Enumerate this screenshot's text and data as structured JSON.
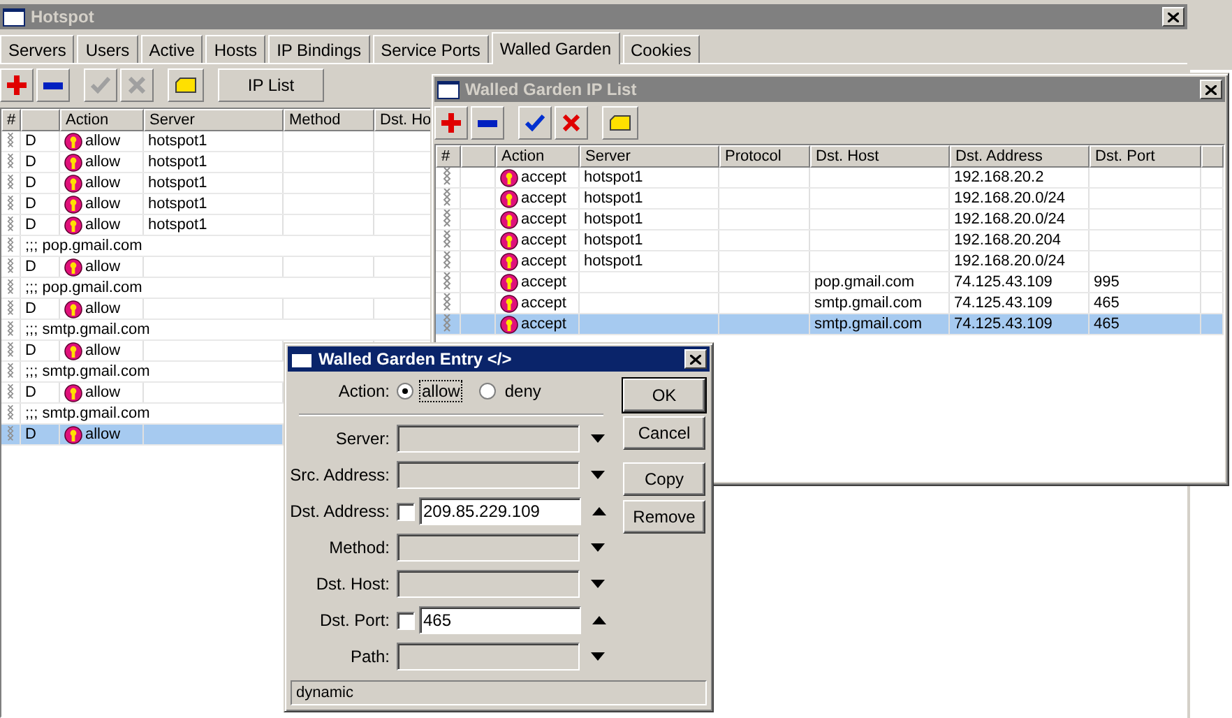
{
  "hotspot_window": {
    "title": "Hotspot",
    "tabs": [
      {
        "label": "Servers",
        "selected": false
      },
      {
        "label": "Users",
        "selected": false
      },
      {
        "label": "Active",
        "selected": false
      },
      {
        "label": "Hosts",
        "selected": false
      },
      {
        "label": "IP Bindings",
        "selected": false
      },
      {
        "label": "Service Ports",
        "selected": false
      },
      {
        "label": "Walled Garden",
        "selected": true
      },
      {
        "label": "Cookies",
        "selected": false
      }
    ],
    "toolbar": [
      {
        "kind": "add",
        "disabled": false
      },
      {
        "kind": "remove",
        "disabled": false
      },
      {
        "kind": "enable",
        "disabled": true
      },
      {
        "kind": "disable",
        "disabled": true
      },
      {
        "kind": "comment",
        "disabled": false
      },
      {
        "kind": "text",
        "label": "IP List",
        "disabled": false
      }
    ],
    "columns": [
      "#",
      "Action",
      "Server",
      "Method",
      "Dst. Ho"
    ],
    "rows": [
      {
        "kind": "entry",
        "flag": "D",
        "action": "allow",
        "server": "hotspot1",
        "selected": false
      },
      {
        "kind": "entry",
        "flag": "D",
        "action": "allow",
        "server": "hotspot1",
        "selected": false
      },
      {
        "kind": "entry",
        "flag": "D",
        "action": "allow",
        "server": "hotspot1",
        "selected": false
      },
      {
        "kind": "entry",
        "flag": "D",
        "action": "allow",
        "server": "hotspot1",
        "selected": false
      },
      {
        "kind": "entry",
        "flag": "D",
        "action": "allow",
        "server": "hotspot1",
        "selected": false
      },
      {
        "kind": "comment",
        "text": ";;; pop.gmail.com",
        "selected": false
      },
      {
        "kind": "entry",
        "flag": "D",
        "action": "allow",
        "selected": false
      },
      {
        "kind": "comment",
        "text": ";;; pop.gmail.com",
        "selected": false
      },
      {
        "kind": "entry",
        "flag": "D",
        "action": "allow",
        "selected": false
      },
      {
        "kind": "comment",
        "text": ";;; smtp.gmail.com",
        "selected": false
      },
      {
        "kind": "entry",
        "flag": "D",
        "action": "allow",
        "selected": false
      },
      {
        "kind": "comment",
        "text": ";;; smtp.gmail.com",
        "selected": false
      },
      {
        "kind": "entry",
        "flag": "D",
        "action": "allow",
        "selected": false
      },
      {
        "kind": "comment",
        "text": ";;; smtp.gmail.com",
        "selected": false
      },
      {
        "kind": "entry",
        "flag": "D",
        "action": "allow",
        "selected": true
      }
    ]
  },
  "ip_list_window": {
    "title": "Walled Garden IP List",
    "toolbar": [
      {
        "kind": "add",
        "disabled": false
      },
      {
        "kind": "remove",
        "disabled": false
      },
      {
        "kind": "enable",
        "disabled": false
      },
      {
        "kind": "disable",
        "disabled": false
      },
      {
        "kind": "comment",
        "disabled": false
      }
    ],
    "columns": [
      "#",
      "Action",
      "Server",
      "Protocol",
      "Dst. Host",
      "Dst. Address",
      "Dst. Port"
    ],
    "rows": [
      {
        "action": "accept",
        "server": "hotspot1",
        "dst_address": "192.168.20.2",
        "selected": false
      },
      {
        "action": "accept",
        "server": "hotspot1",
        "dst_address": "192.168.20.0/24",
        "selected": false
      },
      {
        "action": "accept",
        "server": "hotspot1",
        "dst_address": "192.168.20.0/24",
        "selected": false
      },
      {
        "action": "accept",
        "server": "hotspot1",
        "dst_address": "192.168.20.204",
        "selected": false
      },
      {
        "action": "accept",
        "server": "hotspot1",
        "dst_address": "192.168.20.0/24",
        "selected": false
      },
      {
        "action": "accept",
        "dst_host": "pop.gmail.com",
        "dst_address": "74.125.43.109",
        "dst_port": "995",
        "selected": false
      },
      {
        "action": "accept",
        "dst_host": "smtp.gmail.com",
        "dst_address": "74.125.43.109",
        "dst_port": "465",
        "selected": false
      },
      {
        "action": "accept",
        "dst_host": "smtp.gmail.com",
        "dst_address": "74.125.43.109",
        "dst_port": "465",
        "selected": true
      }
    ]
  },
  "entry_dialog": {
    "title": "Walled Garden Entry </>",
    "action": {
      "label": "Action:",
      "options": [
        {
          "label": "allow",
          "selected": true
        },
        {
          "label": "deny",
          "selected": false
        }
      ]
    },
    "fields": [
      {
        "kind": "dropdown",
        "label": "Server:"
      },
      {
        "kind": "dropdown",
        "label": "Src. Address:"
      },
      {
        "kind": "negatable",
        "label": "Dst. Address:",
        "checked": false,
        "value": "209.85.229.109"
      },
      {
        "kind": "dropdown",
        "label": "Method:"
      },
      {
        "kind": "dropdown",
        "label": "Dst. Host:"
      },
      {
        "kind": "negatable",
        "label": "Dst. Port:",
        "checked": false,
        "value": "465"
      },
      {
        "kind": "dropdown",
        "label": "Path:"
      }
    ],
    "buttons": [
      {
        "label": "OK",
        "default": true
      },
      {
        "label": "Cancel",
        "default": false
      },
      {
        "label": "Copy",
        "default": false
      },
      {
        "label": "Remove",
        "default": false
      }
    ],
    "status": "dynamic"
  }
}
